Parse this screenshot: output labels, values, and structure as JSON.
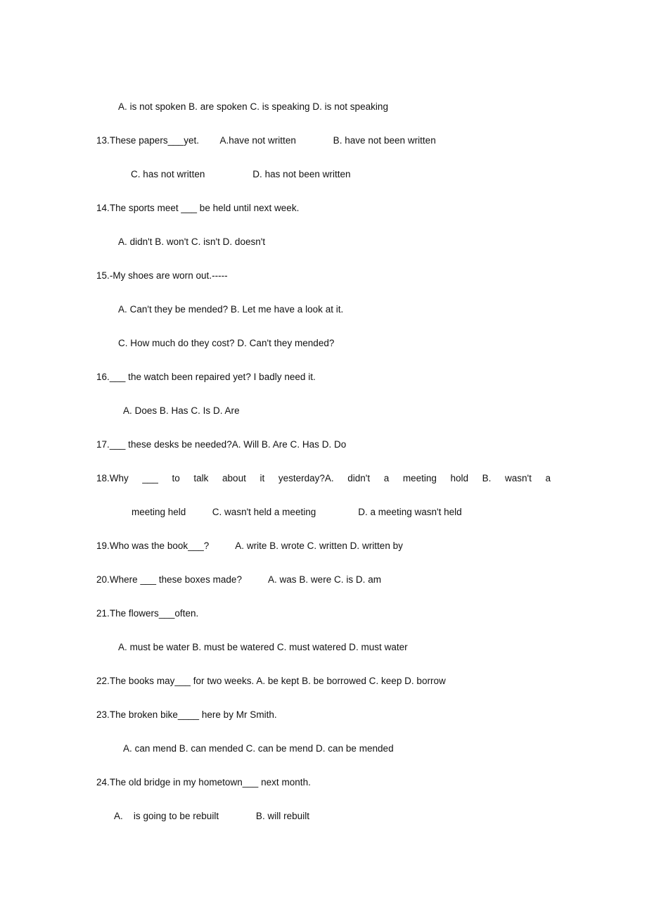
{
  "document": {
    "kind": "scanned-worksheet",
    "subject": "English grammar multiple choice (passive voice)",
    "background_color": "#ffffff",
    "text_color": "#111111"
  },
  "lines": [
    {
      "id": "l01",
      "indent": "ind-31",
      "text": "A. is not spoken B. are spoken C. is speaking D. is not speaking"
    },
    {
      "id": "l02",
      "indent": "ind-0",
      "text": "13.These papers___yet.        A.have not written              B. have not been written"
    },
    {
      "id": "l03",
      "indent": "ind-49",
      "text": "C. has not written                  D. has not been written"
    },
    {
      "id": "l04",
      "indent": "ind-0",
      "text": "14.The sports meet ___ be held until next week."
    },
    {
      "id": "l05",
      "indent": "ind-31",
      "text": "A. didn't B. won't C. isn't D. doesn't"
    },
    {
      "id": "l06",
      "indent": "ind-0",
      "text": "15.-My shoes are worn out.-----"
    },
    {
      "id": "l07",
      "indent": "ind-31",
      "text": "A. Can't they be mended? B. Let me have a look at it."
    },
    {
      "id": "l08",
      "indent": "ind-31",
      "text": "C. How much do they cost? D. Can't they mended?"
    },
    {
      "id": "l09",
      "indent": "ind-0",
      "text": "16.___ the watch been repaired yet? I badly need it."
    },
    {
      "id": "l10",
      "indent": "ind-38",
      "text": "A. Does B. Has C. Is D. Are"
    },
    {
      "id": "l11",
      "indent": "ind-0",
      "text": "17.___ these desks be needed?A. Will B. Are C. Has D. Do"
    },
    {
      "id": "l13",
      "indent": "ind-50",
      "text": "meeting held          C. wasn't held a meeting                D. a meeting wasn't held"
    },
    {
      "id": "l14",
      "indent": "ind-0",
      "text": "19.Who was the book___?          A. write B. wrote C. written D. written by"
    },
    {
      "id": "l15",
      "indent": "ind-0",
      "text": "20.Where ___ these boxes made?          A. was B. were C. is D. am"
    },
    {
      "id": "l16",
      "indent": "ind-0",
      "text": "21.The flowers___often."
    },
    {
      "id": "l17",
      "indent": "ind-31",
      "text": "A. must be water B. must be watered C. must watered D. must water"
    },
    {
      "id": "l18",
      "indent": "ind-0",
      "text": "22.The books may___ for two weeks. A. be kept B. be borrowed C. keep D. borrow"
    },
    {
      "id": "l19",
      "indent": "ind-0",
      "text": "23.The broken bike____ here by Mr Smith."
    },
    {
      "id": "l20",
      "indent": "ind-38",
      "text": "A. can mend B. can mended C. can be mend D. can be mended"
    },
    {
      "id": "l21",
      "indent": "ind-0",
      "text": "24.The old bridge in my hometown___ next month."
    },
    {
      "id": "l22",
      "indent": "ind-25",
      "text": "A.    is going to be rebuilt              B. will rebuilt"
    }
  ],
  "question18": {
    "first_line_justified": "18.Why ___ to talk about it yesterday?A. didn't a meeting hold B. wasn't a"
  }
}
